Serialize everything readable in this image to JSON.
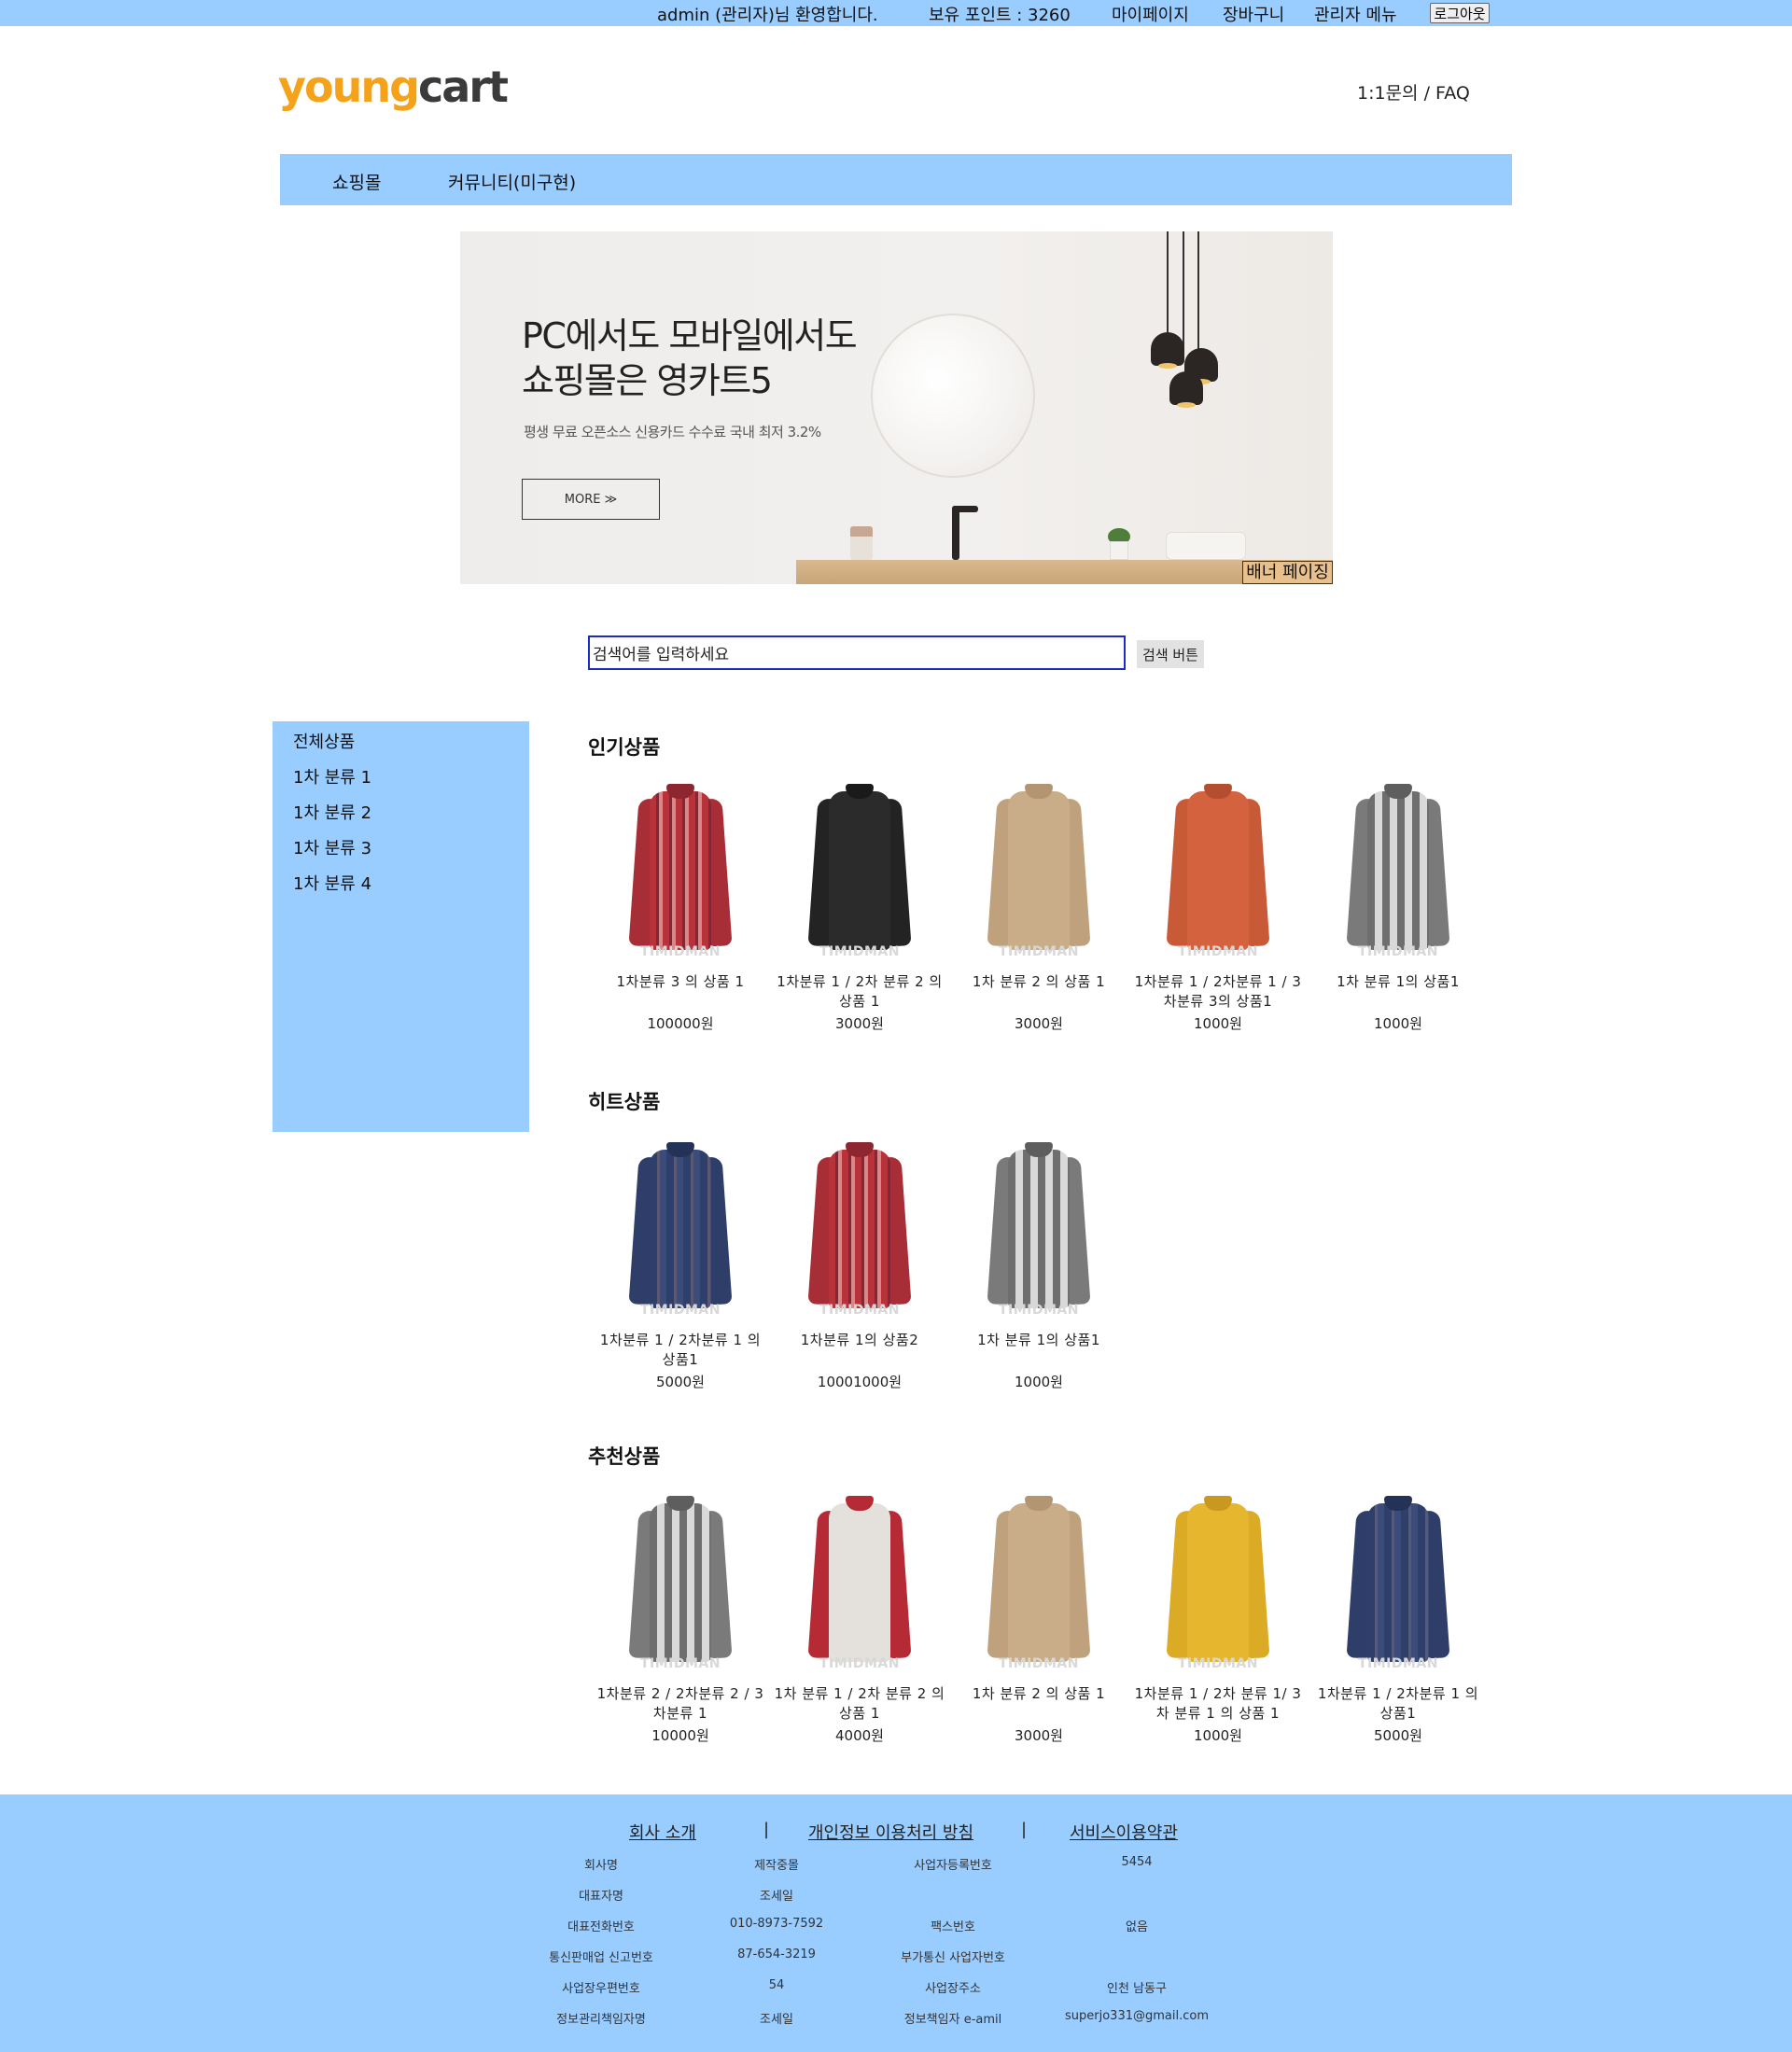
{
  "topbar": {
    "welcome": "admin (관리자)님 환영합니다.",
    "points": "보유 포인트 : 3260",
    "mypage": "마이페이지",
    "cart": "장바구니",
    "admin_menu": "관리자 메뉴",
    "logout": "로그아웃"
  },
  "header": {
    "logo_a": "young",
    "logo_b": "cart",
    "help": "1:1문의 / FAQ"
  },
  "nav": {
    "shop": "쇼핑몰",
    "community": "커뮤니티(미구현)"
  },
  "banner": {
    "title_line1": "PC에서도 모바일에서도",
    "title_line2": "쇼핑몰은 영카트5",
    "subtitle": "평생 무료 오픈소스 신용카드 수수료 국내 최저 3.2%",
    "more": "MORE ≫",
    "page_button": "배너 페이징"
  },
  "search": {
    "value": "검색어를 입력하세요",
    "button": "검색 버튼"
  },
  "sidebar": {
    "items": [
      "전체상품",
      "1차 분류 1",
      "1차 분류 2",
      "1차 분류 3",
      "1차 분류 4"
    ]
  },
  "sections": [
    {
      "title": "인기상품",
      "products": [
        {
          "name": "1차분류 3 의 상품 1",
          "price": "100000원",
          "style": "red-check"
        },
        {
          "name": "1차분류 1 / 2차 분류 2 의 상품 1",
          "price": "3000원",
          "style": "black"
        },
        {
          "name": "1차 분류 2 의 상품 1",
          "price": "3000원",
          "style": "tan"
        },
        {
          "name": "1차분류 1 / 2차분류 1 / 3차분류 3의 상품1",
          "price": "1000원",
          "style": "orange"
        },
        {
          "name": "1차 분류 1의 상품1",
          "price": "1000원",
          "style": "gray-check"
        }
      ]
    },
    {
      "title": "히트상품",
      "products": [
        {
          "name": "1차분류 1 / 2차분류 1 의 상품1",
          "price": "5000원",
          "style": "navy-check"
        },
        {
          "name": "1차분류 1의 상품2",
          "price": "10001000원",
          "style": "red-check"
        },
        {
          "name": "1차 분류 1의 상품1",
          "price": "1000원",
          "style": "gray-check"
        }
      ]
    },
    {
      "title": "추천상품",
      "products": [
        {
          "name": "1차분류 2 / 2차분류 2 / 3차분류 1",
          "price": "10000원",
          "style": "gray-check"
        },
        {
          "name": "1차 분류 1 / 2차 분류 2 의 상품 1",
          "price": "4000원",
          "style": "raglan"
        },
        {
          "name": "1차 분류 2 의 상품 1",
          "price": "3000원",
          "style": "tan"
        },
        {
          "name": "1차분류 1 / 2차 분류 1/ 3차 분류 1 의 상품 1",
          "price": "1000원",
          "style": "yellow"
        },
        {
          "name": "1차분류 1 / 2차분류 1 의 상품1",
          "price": "5000원",
          "style": "navy-check"
        }
      ]
    }
  ],
  "watermark": "TIMIDMAN",
  "footer": {
    "links": [
      "회사 소개",
      "개인정보 이용처리 방침",
      "서비스이용약관"
    ],
    "separator": "|",
    "info": [
      [
        "회사명",
        "제작중몰",
        "사업자등록번호",
        "5454"
      ],
      [
        "대표자명",
        "조세일",
        "",
        ""
      ],
      [
        "대표전화번호",
        "010-8973-7592",
        "팩스번호",
        "없음"
      ],
      [
        "통신판매업 신고번호",
        "87-654-3219",
        "부가통신 사업자번호",
        ""
      ],
      [
        "사업장우편번호",
        "54",
        "사업장주소",
        "인천 남동구"
      ],
      [
        "정보관리책임자명",
        "조세일",
        "정보책임자 e-amil",
        "superjo331@gmail.com"
      ]
    ]
  },
  "colors": {
    "accent": "#99ccff",
    "logo_orange": "#f5a21b",
    "logo_gray": "#3a3a3a",
    "search_border": "#1a2bc4"
  }
}
